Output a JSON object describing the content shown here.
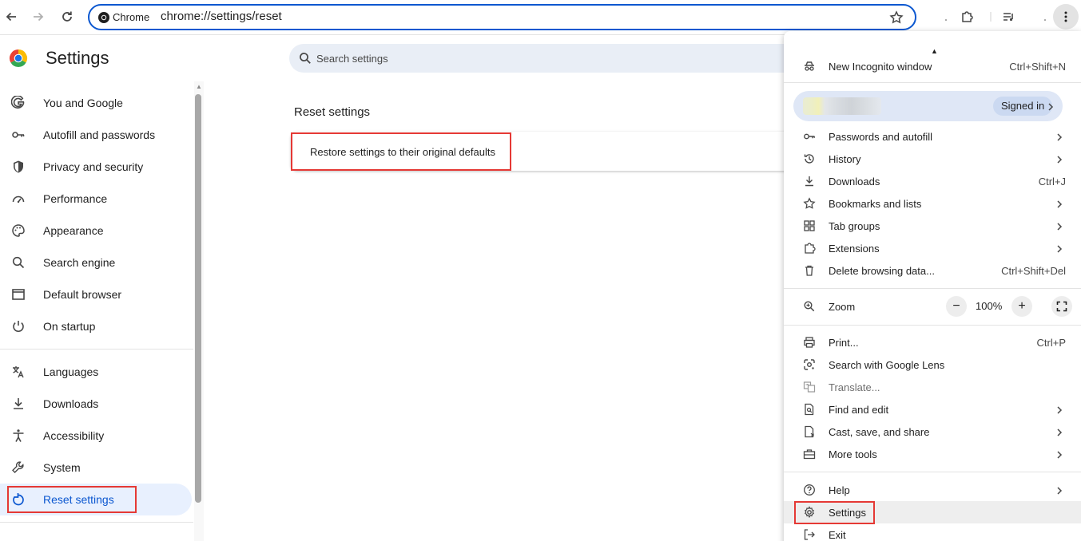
{
  "toolbar": {
    "chip_label": "Chrome",
    "url": "chrome://settings/reset"
  },
  "header": {
    "title": "Settings",
    "search_placeholder": "Search settings"
  },
  "sidebar": {
    "items": [
      {
        "label": "You and Google",
        "icon": "google-g-icon"
      },
      {
        "label": "Autofill and passwords",
        "icon": "key-icon"
      },
      {
        "label": "Privacy and security",
        "icon": "shield-icon"
      },
      {
        "label": "Performance",
        "icon": "speedometer-icon"
      },
      {
        "label": "Appearance",
        "icon": "palette-icon"
      },
      {
        "label": "Search engine",
        "icon": "search-icon"
      },
      {
        "label": "Default browser",
        "icon": "browser-window-icon"
      },
      {
        "label": "On startup",
        "icon": "power-icon"
      },
      {
        "label": "Languages",
        "icon": "translate-icon"
      },
      {
        "label": "Downloads",
        "icon": "download-icon"
      },
      {
        "label": "Accessibility",
        "icon": "accessibility-icon"
      },
      {
        "label": "System",
        "icon": "wrench-icon"
      },
      {
        "label": "Reset settings",
        "icon": "reset-icon",
        "active": true
      }
    ]
  },
  "main": {
    "section_title": "Reset settings",
    "card_label": "Restore settings to their original defaults"
  },
  "menu": {
    "incognito": {
      "label": "New Incognito window",
      "shortcut": "Ctrl+Shift+N"
    },
    "profile": {
      "status": "Signed in"
    },
    "group1": [
      {
        "label": "Passwords and autofill",
        "icon": "key-icon",
        "submenu": true
      },
      {
        "label": "History",
        "icon": "history-icon",
        "submenu": true
      },
      {
        "label": "Downloads",
        "icon": "download-icon",
        "shortcut": "Ctrl+J"
      },
      {
        "label": "Bookmarks and lists",
        "icon": "star-icon",
        "submenu": true
      },
      {
        "label": "Tab groups",
        "icon": "tab-groups-icon",
        "submenu": true
      },
      {
        "label": "Extensions",
        "icon": "puzzle-icon",
        "submenu": true
      },
      {
        "label": "Delete browsing data...",
        "icon": "trash-icon",
        "shortcut": "Ctrl+Shift+Del"
      }
    ],
    "zoom": {
      "label": "Zoom",
      "value": "100%",
      "minus": "−",
      "plus": "+"
    },
    "group2": [
      {
        "label": "Print...",
        "icon": "print-icon",
        "shortcut": "Ctrl+P"
      },
      {
        "label": "Search with Google Lens",
        "icon": "lens-icon"
      },
      {
        "label": "Translate...",
        "icon": "translate-icon",
        "disabled": true
      },
      {
        "label": "Find and edit",
        "icon": "find-file-icon",
        "submenu": true
      },
      {
        "label": "Cast, save, and share",
        "icon": "cast-icon",
        "submenu": true
      },
      {
        "label": "More tools",
        "icon": "toolbox-icon",
        "submenu": true
      }
    ],
    "group3": [
      {
        "label": "Help",
        "icon": "help-icon",
        "submenu": true
      },
      {
        "label": "Settings",
        "icon": "gear-icon"
      },
      {
        "label": "Exit",
        "icon": "exit-icon"
      }
    ]
  },
  "colors": {
    "accent": "#0b57d0",
    "active_nav_bg": "#e8f0fe",
    "highlight": "#e53935"
  }
}
